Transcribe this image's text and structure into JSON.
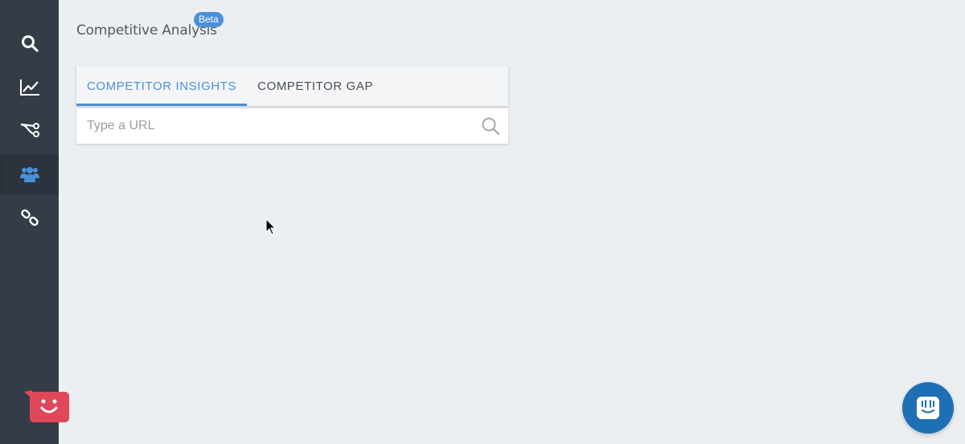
{
  "app": {
    "page_title": "Competitive Analysis",
    "beta_badge": "Beta"
  },
  "sidebar": {
    "items": [
      {
        "icon": "search-icon",
        "active": false
      },
      {
        "icon": "line-chart-icon",
        "active": false
      },
      {
        "icon": "connections-icon",
        "active": false
      },
      {
        "icon": "users-icon",
        "active": true
      },
      {
        "icon": "link-icon",
        "active": false
      }
    ],
    "bottom_widget": "bot-face-icon"
  },
  "tabs": [
    {
      "label": "COMPETITOR INSIGHTS",
      "active": true
    },
    {
      "label": "COMPETITOR GAP",
      "active": false
    }
  ],
  "search": {
    "value": "",
    "placeholder": "Type a URL",
    "button_icon": "search-icon"
  },
  "chat": {
    "icon": "chat-icon"
  },
  "colors": {
    "accent": "#4a90d9",
    "sidebar": "#343d47",
    "background": "#eceff2",
    "bot": "#e0485a",
    "chat": "#1f6fb5"
  }
}
